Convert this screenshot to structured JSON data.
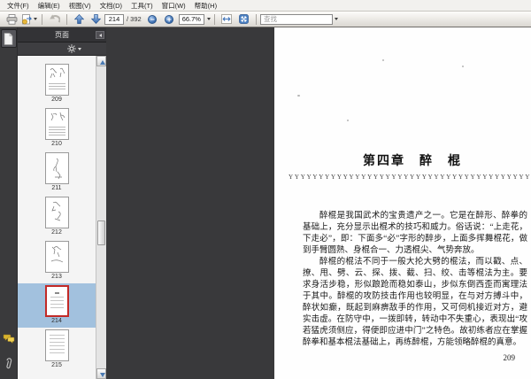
{
  "menu_bar": {
    "items": [
      "文件(F)",
      "编辑(E)",
      "视图(V)",
      "文档(D)",
      "工具(T)",
      "窗口(W)",
      "帮助(H)"
    ]
  },
  "toolbar": {
    "current_page": "214",
    "total_pages": "/ 392",
    "zoom_level": "66.7%",
    "find_placeholder": "查找"
  },
  "sidebar": {
    "panel_title": "页面",
    "selected_page": "214",
    "thumbnails": [
      {
        "page": "209"
      },
      {
        "page": "210"
      },
      {
        "page": "211"
      },
      {
        "page": "212"
      },
      {
        "page": "213"
      },
      {
        "page": "214",
        "selected": true
      },
      {
        "page": "215"
      }
    ]
  },
  "document": {
    "heading": "第四章　醉　棍",
    "ornament": "YYYYYYYYYYYYYYYYYYYYYYYYYYYYYYYYYYYYYYYYYYYYYYYY",
    "paragraphs": [
      "醉棍是我国武术的宝贵遗产之一。它是在醉形、醉拳的基础上，充分显示出棍术的技巧和威力。俗话说：“上走花，下走必”，即：下面多“必”字形的醉步，上面多挥舞棍花，做到手臂圆熟、身棍合一、力透棍尖、气势奔放。",
      "醉棍的棍法不同于一般大抡大劈的棍法，而以戳、点、撩、甩、劈、云、探、拨、截、扫、绞、击等棍法为主。要求身活步稳，形似踉跄而稳如泰山，步似东倒西歪而寓理法于其中。醉棍的攻防技击作用也较明显，在与对方搏斗中，醉状如癫，既起到麻痹敌手的作用，又可伺机接近对方，避实击虚。在防守中，一拨即转，转动中不失重心，表现出“攻若猛虎须侧应，得便即应进中门”之特色。故初练者应在掌握醉拳和基本棍法基础上，再练醉棍，方能领略醉棍的真意。"
    ],
    "page_number": "209"
  },
  "icons": {
    "zoom_out_glyph": "−",
    "zoom_in_glyph": "+",
    "caret_glyph": "▾"
  },
  "colors": {
    "accent_blue": "#3a6fb5",
    "selection_blue": "#a2c1de",
    "selected_border_red": "#c22a27",
    "dark_panel": "#3a3a3c",
    "toolbar_bg": "#e8e5e0"
  }
}
